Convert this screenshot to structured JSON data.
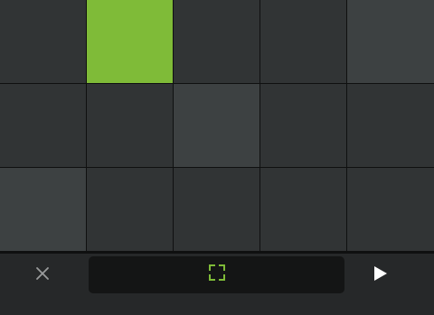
{
  "colors": {
    "background": "#262829",
    "pad_default": "#313435",
    "pad_light": "#3d4142",
    "pad_active": "#7fbb38",
    "grid_line": "#0f1010",
    "panel": "#141515",
    "accent": "#7fbb38",
    "icon_muted": "#9a9c9d",
    "icon_white": "#ffffff"
  },
  "pads": {
    "rows": 3,
    "cols": 5,
    "states": [
      [
        "default",
        "active",
        "default",
        "default",
        "light"
      ],
      [
        "default",
        "default",
        "light",
        "default",
        "default"
      ],
      [
        "light",
        "default",
        "default",
        "default",
        "default"
      ]
    ]
  },
  "toolbar": {
    "close_icon": "close-icon",
    "expand_icon": "expand-corners-icon",
    "play_icon": "play-icon"
  }
}
